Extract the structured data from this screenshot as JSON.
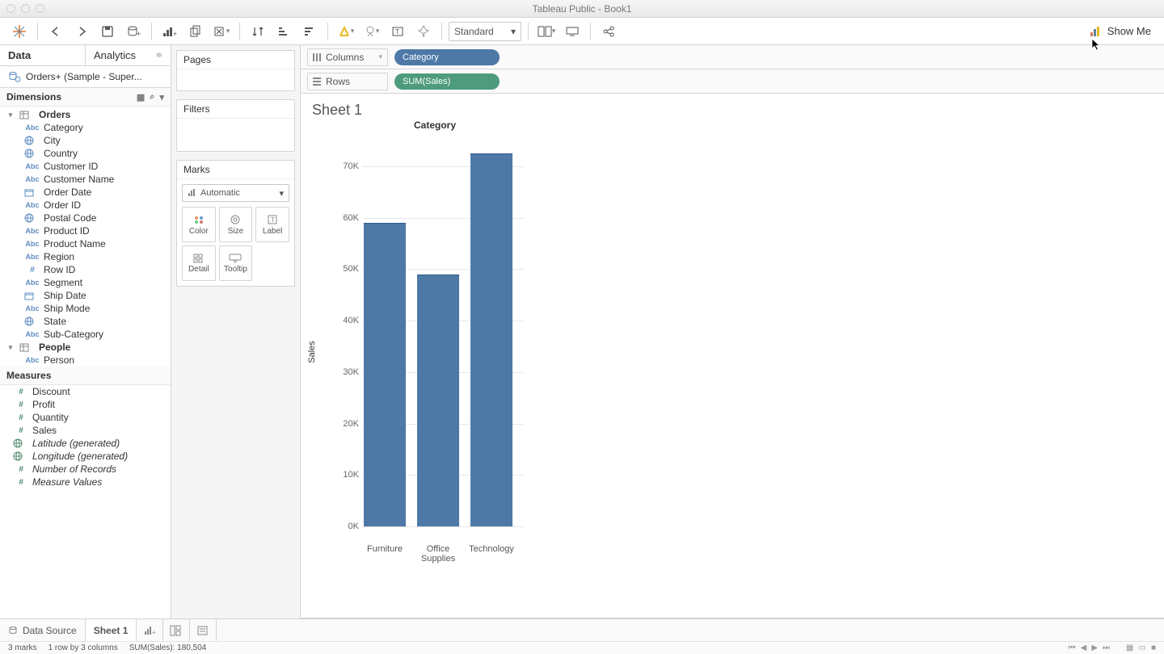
{
  "window": {
    "title": "Tableau Public - Book1"
  },
  "toolbar": {
    "fit_select": "Standard",
    "show_me": "Show Me"
  },
  "sidebar": {
    "tabs": {
      "data": "Data",
      "analytics": "Analytics"
    },
    "datasource": "Orders+ (Sample - Super...",
    "dimensions_label": "Dimensions",
    "measures_label": "Measures",
    "tables": [
      {
        "name": "Orders",
        "fields": [
          {
            "type": "Abc",
            "label": "Category"
          },
          {
            "type": "globe",
            "label": "City"
          },
          {
            "type": "globe",
            "label": "Country"
          },
          {
            "type": "Abc",
            "label": "Customer ID"
          },
          {
            "type": "Abc",
            "label": "Customer Name"
          },
          {
            "type": "date",
            "label": "Order Date"
          },
          {
            "type": "Abc",
            "label": "Order ID"
          },
          {
            "type": "globe",
            "label": "Postal Code"
          },
          {
            "type": "Abc",
            "label": "Product ID"
          },
          {
            "type": "Abc",
            "label": "Product Name"
          },
          {
            "type": "Abc",
            "label": "Region"
          },
          {
            "type": "hash",
            "label": "Row ID"
          },
          {
            "type": "Abc",
            "label": "Segment"
          },
          {
            "type": "date",
            "label": "Ship Date"
          },
          {
            "type": "Abc",
            "label": "Ship Mode"
          },
          {
            "type": "globe",
            "label": "State"
          },
          {
            "type": "Abc",
            "label": "Sub-Category"
          }
        ]
      },
      {
        "name": "People",
        "fields": [
          {
            "type": "Abc",
            "label": "Person"
          }
        ]
      }
    ],
    "measures": [
      {
        "type": "hash",
        "label": "Discount"
      },
      {
        "type": "hash",
        "label": "Profit"
      },
      {
        "type": "hash",
        "label": "Quantity"
      },
      {
        "type": "hash",
        "label": "Sales"
      },
      {
        "type": "globe",
        "label": "Latitude (generated)",
        "italic": true
      },
      {
        "type": "globe",
        "label": "Longitude (generated)",
        "italic": true
      },
      {
        "type": "hash",
        "label": "Number of Records",
        "italic": true
      },
      {
        "type": "hash",
        "label": "Measure Values",
        "italic": true
      }
    ]
  },
  "cards": {
    "pages": "Pages",
    "filters": "Filters",
    "marks": "Marks",
    "marks_type": "Automatic",
    "buttons": {
      "color": "Color",
      "size": "Size",
      "label": "Label",
      "detail": "Detail",
      "tooltip": "Tooltip"
    }
  },
  "shelves": {
    "columns_label": "Columns",
    "rows_label": "Rows",
    "columns_pill": "Category",
    "rows_pill": "SUM(Sales)"
  },
  "sheet": {
    "title": "Sheet 1",
    "chart_axis_title": "Category"
  },
  "chart_data": {
    "type": "bar",
    "title": "Category",
    "xlabel": "",
    "ylabel": "Sales",
    "categories": [
      "Furniture",
      "Office Supplies",
      "Technology"
    ],
    "values": [
      59000,
      49000,
      72500
    ],
    "ylim": [
      0,
      75000
    ],
    "yticks": [
      0,
      10000,
      20000,
      30000,
      40000,
      50000,
      60000,
      70000
    ],
    "ytick_labels": [
      "0K",
      "10K",
      "20K",
      "30K",
      "40K",
      "50K",
      "60K",
      "70K"
    ]
  },
  "bottom_tabs": {
    "data_source": "Data Source",
    "sheet1": "Sheet 1"
  },
  "status": {
    "marks": "3 marks",
    "dims": "1 row by 3 columns",
    "agg": "SUM(Sales): 180,504"
  }
}
